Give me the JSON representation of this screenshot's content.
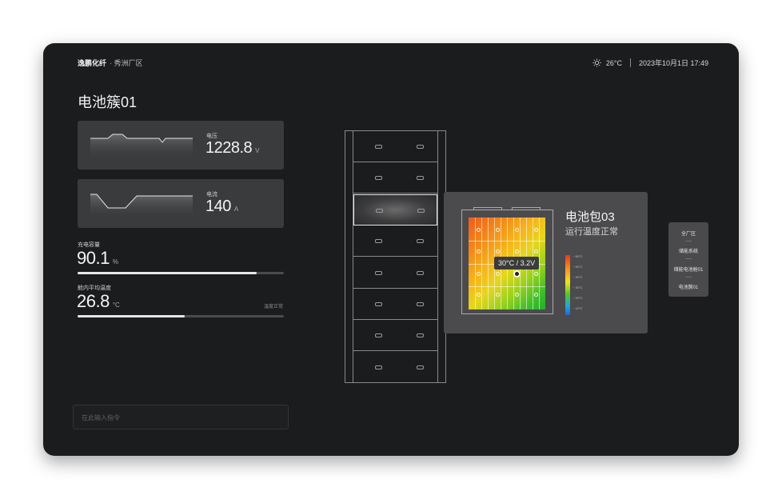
{
  "header": {
    "brand": "逸鹏化纤",
    "brand_sub": "· 秀洲厂区",
    "weather_icon": "sun-icon",
    "temperature": "26°C",
    "datetime": "2023年10月1日  17:49"
  },
  "page": {
    "title": "电池簇01"
  },
  "voltage": {
    "label": "电压",
    "value": "1228.8",
    "unit": "V"
  },
  "current": {
    "label": "电流",
    "value": "140",
    "unit": "A"
  },
  "capacity": {
    "label": "充电容量",
    "value": "90.1",
    "unit": "%",
    "progress": 0.87
  },
  "cabin_temp": {
    "label": "舱内平均温度",
    "value": "26.8",
    "unit": "°C",
    "status": "温度正常",
    "progress": 0.52
  },
  "command": {
    "placeholder": "在此输入指令"
  },
  "rack": {
    "slot_count": 8,
    "active_slot": 3
  },
  "pack": {
    "name": "电池包03",
    "state": "运行温度正常",
    "tooltip": "30°C / 3.2V",
    "legend": [
      "~ 60°C",
      "~ 50°C",
      "~ 40°C",
      "~ 30°C",
      "~ 20°C",
      "~ 10°C"
    ]
  },
  "breadcrumbs": [
    "全厂区",
    "储能系统",
    "储能电池舱01",
    "电池簇01"
  ]
}
